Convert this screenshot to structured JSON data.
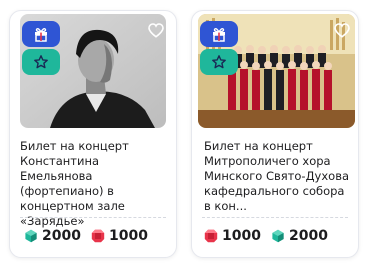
{
  "cards": [
    {
      "title": "Билет на концерт Константина Емельянова (фортепиано) в концертном зале «Зарядье»",
      "badges": [
        "gift-icon",
        "star-icon"
      ],
      "favorite_icon": "heart-outline-icon",
      "prices": [
        {
          "gem": "green-gem-icon",
          "color": "#1fb79b",
          "value": "2000"
        },
        {
          "gem": "red-gem-icon",
          "color": "#e8344a",
          "value": "1000"
        }
      ]
    },
    {
      "title": "Билет на концерт Митрополичего хора Минского Свято-Духова кафедрального собора в кон...",
      "badges": [
        "gift-icon",
        "star-icon"
      ],
      "favorite_icon": "heart-outline-icon",
      "prices": [
        {
          "gem": "red-gem-icon",
          "color": "#e8344a",
          "value": "1000"
        },
        {
          "gem": "green-gem-icon",
          "color": "#1fb79b",
          "value": "2000"
        }
      ]
    }
  ],
  "colors": {
    "badge_gift": "#2f55d4",
    "badge_star": "#1fb79b",
    "gem_green": "#1fb79b",
    "gem_red": "#e8344a"
  }
}
